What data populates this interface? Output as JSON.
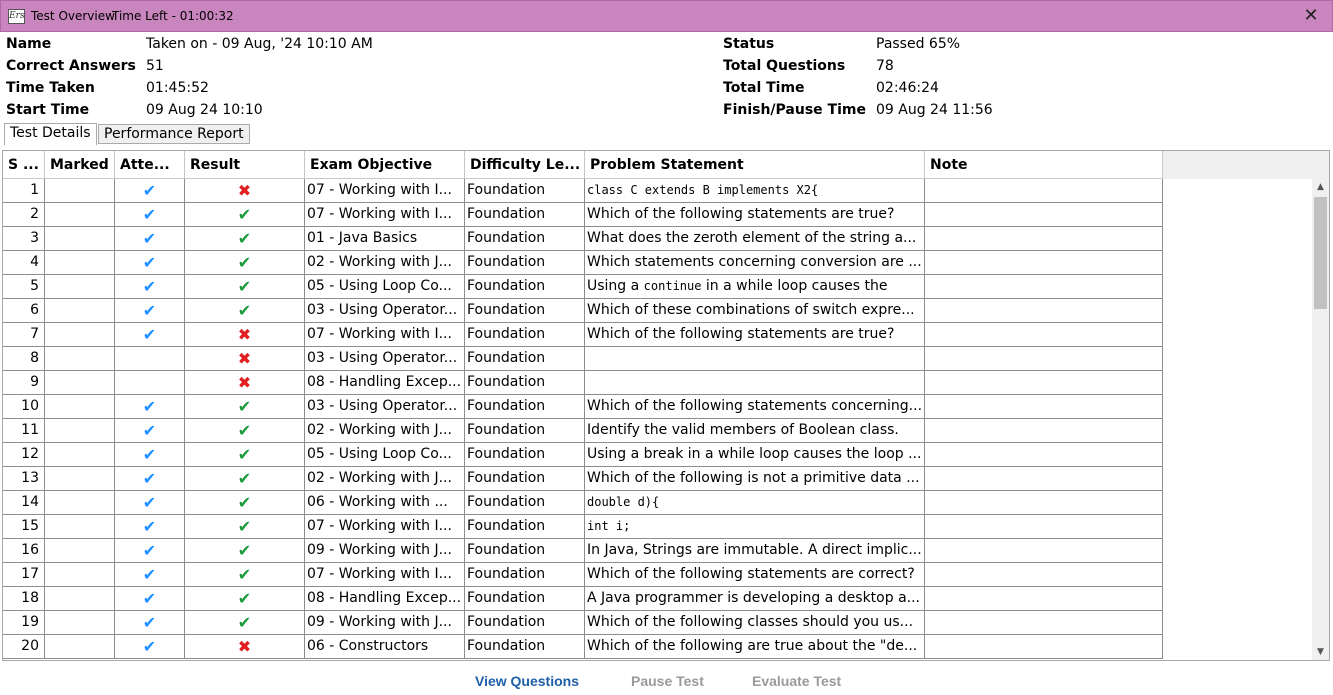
{
  "window": {
    "title": "Test Overview",
    "time_left": "Time Left - 01:00:32",
    "icon_label": "Ers",
    "close_label": "✕"
  },
  "summary": {
    "name_label": "Name",
    "name_value": "Taken on - 09 Aug, '24 10:10 AM",
    "correct_label": "Correct Answers",
    "correct_value": "51",
    "time_taken_label": "Time Taken",
    "time_taken_value": "01:45:52",
    "start_label": "Start Time",
    "start_value": "09 Aug 24 10:10",
    "status_label": "Status",
    "status_value": "Passed 65%",
    "total_q_label": "Total Questions",
    "total_q_value": "78",
    "total_time_label": "Total Time",
    "total_time_value": "02:46:24",
    "finish_label": "Finish/Pause Time",
    "finish_value": "09 Aug 24 11:56"
  },
  "tabs": [
    {
      "label": "Test Details",
      "active": true
    },
    {
      "label": "Performance Report",
      "active": false
    }
  ],
  "table": {
    "headers": [
      "S ...",
      "Marked",
      "Atte...",
      "Result",
      "Exam Objective",
      "Difficulty Le...",
      "Problem Statement",
      "Note"
    ],
    "rows": [
      {
        "sno": "1",
        "attempted": true,
        "result": "fail",
        "objective": "07 - Working with I...",
        "difficulty": "Foundation",
        "problem": "class C extends B implements X2{",
        "mono": true
      },
      {
        "sno": "2",
        "attempted": true,
        "result": "pass",
        "objective": "07 - Working with I...",
        "difficulty": "Foundation",
        "problem": "Which of the following statements are true?"
      },
      {
        "sno": "3",
        "attempted": true,
        "result": "pass",
        "objective": "01 - Java Basics",
        "difficulty": "Foundation",
        "problem": "What does the zeroth element of the string a..."
      },
      {
        "sno": "4",
        "attempted": true,
        "result": "pass",
        "objective": "02 - Working with J...",
        "difficulty": "Foundation",
        "problem": "Which statements concerning conversion are ..."
      },
      {
        "sno": "5",
        "attempted": true,
        "result": "pass",
        "objective": "05 - Using Loop Co...",
        "difficulty": "Foundation",
        "problem_pre": "Using a ",
        "problem_code": "continue",
        "problem_post": " in a while loop causes the"
      },
      {
        "sno": "6",
        "attempted": true,
        "result": "pass",
        "objective": "03 - Using Operator...",
        "difficulty": "Foundation",
        "problem": "Which of these combinations of switch expre..."
      },
      {
        "sno": "7",
        "attempted": true,
        "result": "fail",
        "objective": "07 - Working with I...",
        "difficulty": "Foundation",
        "problem": "Which of the following statements are true?"
      },
      {
        "sno": "8",
        "attempted": false,
        "result": "fail",
        "objective": "03 - Using Operator...",
        "difficulty": "Foundation",
        "problem": ""
      },
      {
        "sno": "9",
        "attempted": false,
        "result": "fail",
        "objective": "08 - Handling Excep...",
        "difficulty": "Foundation",
        "problem": ""
      },
      {
        "sno": "10",
        "attempted": true,
        "result": "pass",
        "objective": "03 - Using Operator...",
        "difficulty": "Foundation",
        "problem": "Which of the following statements concerning..."
      },
      {
        "sno": "11",
        "attempted": true,
        "result": "pass",
        "objective": "02 - Working with J...",
        "difficulty": "Foundation",
        "problem": "Identify the valid members of Boolean class."
      },
      {
        "sno": "12",
        "attempted": true,
        "result": "pass",
        "objective": "05 - Using Loop Co...",
        "difficulty": "Foundation",
        "problem": "Using a break in a while loop causes the loop ..."
      },
      {
        "sno": "13",
        "attempted": true,
        "result": "pass",
        "objective": "02 - Working with J...",
        "difficulty": "Foundation",
        "problem": "Which of the following is not a primitive data ..."
      },
      {
        "sno": "14",
        "attempted": true,
        "result": "pass",
        "objective": "06 - Working with ...",
        "difficulty": "Foundation",
        "problem": "double d){",
        "mono": true
      },
      {
        "sno": "15",
        "attempted": true,
        "result": "pass",
        "objective": "07 - Working with I...",
        "difficulty": "Foundation",
        "problem": "int i;",
        "mono": true
      },
      {
        "sno": "16",
        "attempted": true,
        "result": "pass",
        "objective": "09 - Working with J...",
        "difficulty": "Foundation",
        "problem": "In Java, Strings are immutable. A direct implic..."
      },
      {
        "sno": "17",
        "attempted": true,
        "result": "pass",
        "objective": "07 - Working with I...",
        "difficulty": "Foundation",
        "problem": "Which of the following statements are correct?"
      },
      {
        "sno": "18",
        "attempted": true,
        "result": "pass",
        "objective": "08 - Handling Excep...",
        "difficulty": "Foundation",
        "problem": "A Java programmer is developing a desktop a..."
      },
      {
        "sno": "19",
        "attempted": true,
        "result": "pass",
        "objective": "09 - Working with J...",
        "difficulty": "Foundation",
        "problem": "Which of the following classes should you us..."
      },
      {
        "sno": "20",
        "attempted": true,
        "result": "fail",
        "objective": "06 - Constructors",
        "difficulty": "Foundation",
        "problem": "Which of the following are true about the \"de..."
      }
    ]
  },
  "symbols": {
    "check": "✔",
    "cross": "✖",
    "arrow_up": "▲",
    "arrow_down": "▼"
  },
  "buttons": {
    "view_questions": "View Questions",
    "pause_test": "Pause Test",
    "evaluate_test": "Evaluate Test"
  },
  "colors": {
    "titlebar": "#c985be",
    "attempted_check": "#1e90ff",
    "result_pass": "#1a9a3a",
    "result_fail": "#e02020",
    "link_enabled": "#1f5fa8",
    "link_disabled": "#9a9a9a"
  }
}
